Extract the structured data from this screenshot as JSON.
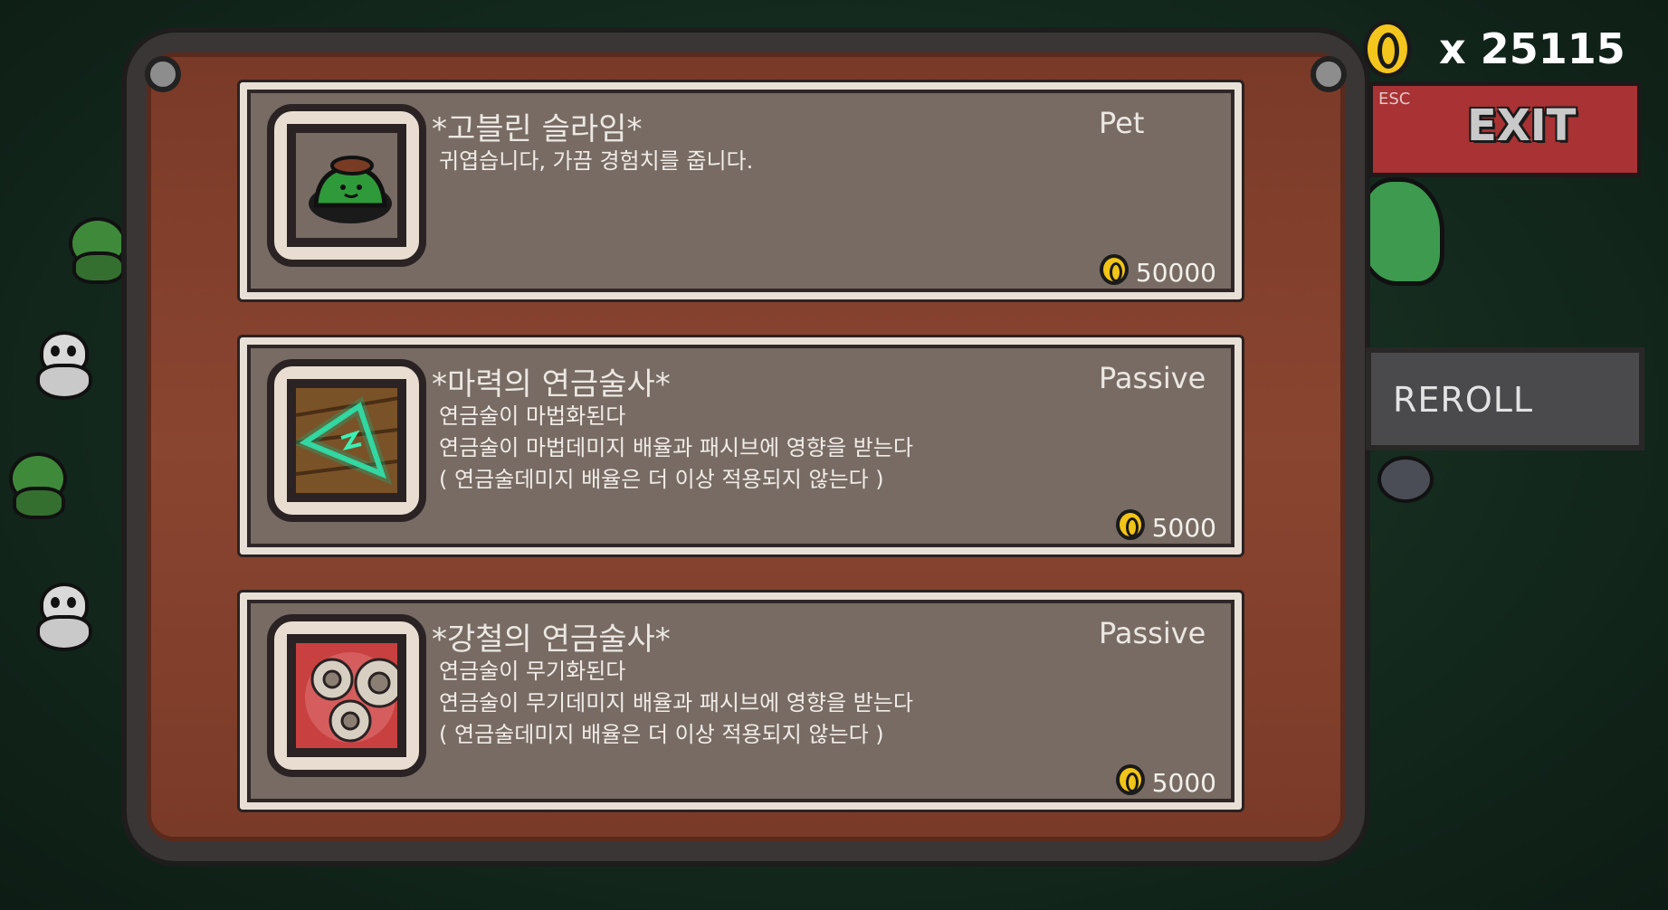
{
  "gold": {
    "amount": "x 25115",
    "icon": "coin-icon"
  },
  "exit_button": {
    "esc_label": "ESC",
    "label": "EXIT"
  },
  "reroll_button": {
    "label": "REROLL"
  },
  "shop_items": [
    {
      "name": "*고블린 슬라임*",
      "type": "Pet",
      "description": "귀엽습니다, 가끔 경험치를 줍니다.",
      "price": "50000",
      "icon": "green-slime-icon"
    },
    {
      "name": "*마력의 연금술사*",
      "type": "Passive",
      "description": "연금술이 마법화된다\n연금술이 마법데미지 배율과 패시브에 영향을 받는다\n( 연금술데미지 배율은 더 이상 적용되지 않는다 )",
      "price": "5000",
      "icon": "magic-triangle-icon"
    },
    {
      "name": "*강철의 연금술사*",
      "type": "Passive",
      "description": "연금술이 무기화된다\n연금술이 무기데미지 배율과 패시브에 영향을 받는다\n( 연금술데미지 배율은 더 이상 적용되지 않는다 )",
      "price": "5000",
      "icon": "gears-icon"
    }
  ],
  "colors": {
    "background": "#142a1e",
    "frame_wood": "#8a4530",
    "card_fill": "#786b64",
    "exit_red": "#a83234",
    "reroll_gray": "#4a4a4c",
    "coin_gold": "#f4c51c"
  }
}
